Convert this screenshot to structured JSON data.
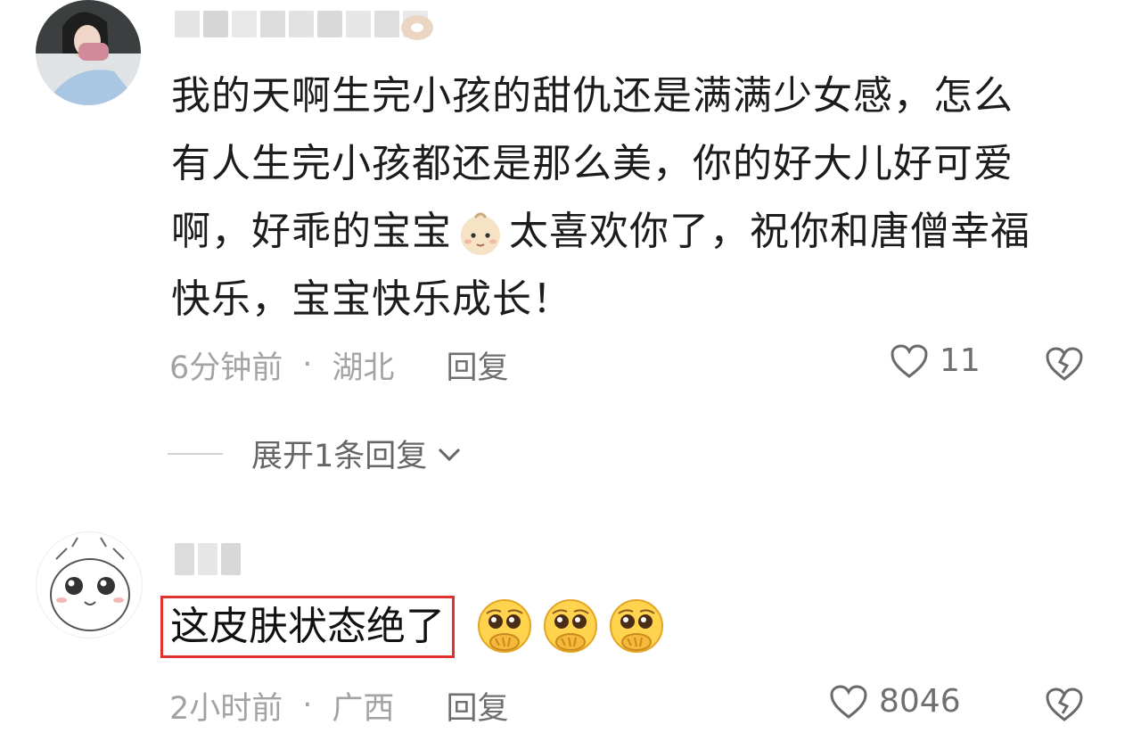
{
  "comments": [
    {
      "text_line1": "我的天啊生完小孩的甜仇还是满满少女感，怎么",
      "text_line2": "有人生完小孩都还是那么美，你的好大儿好可爱",
      "text_line3a": "啊，好乖的宝宝",
      "text_line3b": "太喜欢你了，祝你和唐僧幸福",
      "text_line4": "快乐，宝宝快乐成长！",
      "time": "6分钟前",
      "separator": "·",
      "location": "湖北",
      "reply_label": "回复",
      "like_count": "11",
      "expand_label": "展开1条回复",
      "inline_emoji": "baby-face-emoji"
    },
    {
      "text": "这皮肤状态绝了",
      "time": "2小时前",
      "separator": "·",
      "location": "广西",
      "reply_label": "回复",
      "like_count": "8046",
      "emojis": [
        "pleading-face-emoji",
        "pleading-face-emoji",
        "pleading-face-emoji"
      ],
      "highlight_color": "#e0322d"
    }
  ],
  "icons": {
    "like": "heart-outline-icon",
    "dislike": "broken-heart-icon",
    "expand": "chevron-down-icon"
  }
}
